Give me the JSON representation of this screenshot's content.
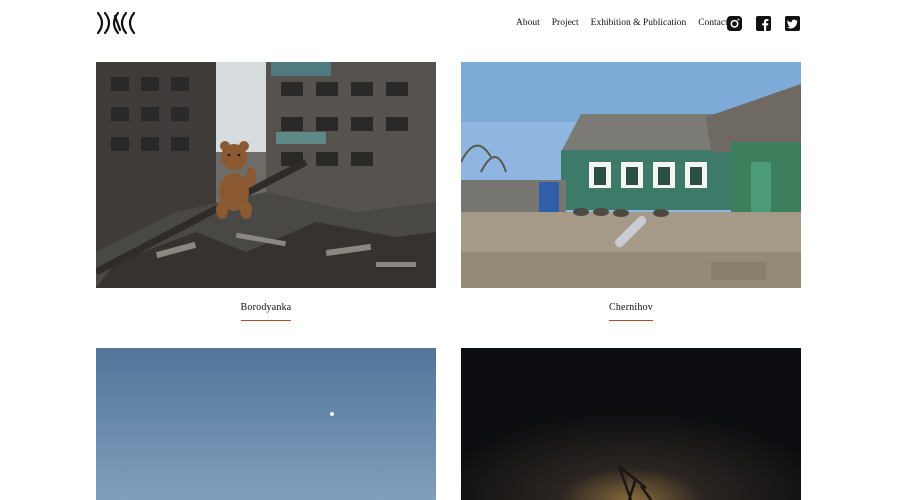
{
  "header": {
    "logo_icon": "studio-logo-icon",
    "nav": [
      {
        "label": "About"
      },
      {
        "label": "Project"
      },
      {
        "label": "Exhibition & Publication"
      },
      {
        "label": "Contact"
      }
    ],
    "social": [
      {
        "icon": "instagram-icon"
      },
      {
        "icon": "facebook-icon"
      },
      {
        "icon": "twitter-icon"
      }
    ]
  },
  "gallery": {
    "accent_color": "#b04a2a",
    "items": [
      {
        "title": "Borodyanka"
      },
      {
        "title": "Chernihov"
      },
      {
        "title": ""
      },
      {
        "title": ""
      }
    ]
  }
}
